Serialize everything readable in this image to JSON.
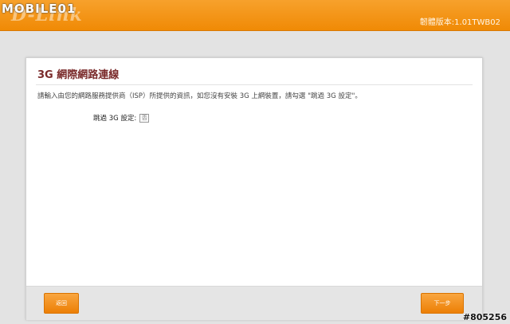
{
  "header": {
    "logo_text": "D-Link",
    "firmware_label": "韌體版本:1.01TWB02"
  },
  "watermark": {
    "top_text": "MOBILE01",
    "bottom_text": "#805256"
  },
  "panel": {
    "title": "3G 網際網路連線",
    "instructions": "請輸入由您的網路服務提供商（ISP）所提供的資訊，如您沒有安裝 3G 上網裝置，請勾選 \"跳過 3G 設定\"。",
    "skip_label": "跳過 3G 設定:",
    "skip_checkbox_text": "否"
  },
  "footer": {
    "back_label": "返回",
    "next_label": "下一步"
  },
  "colors": {
    "header_orange": "#f08a05",
    "title_red": "#7a2a2a",
    "button_orange": "#ec7f05"
  }
}
